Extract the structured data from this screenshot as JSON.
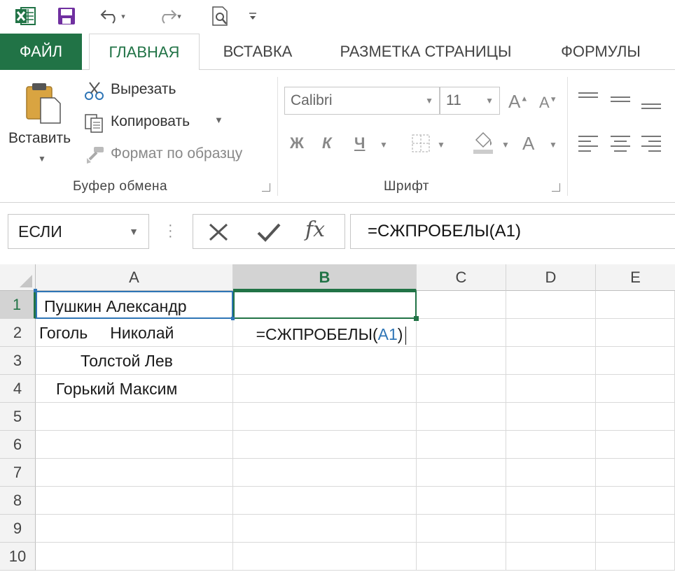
{
  "tabs": {
    "file": "ФАЙЛ",
    "home": "ГЛАВНАЯ",
    "insert": "ВСТАВКА",
    "page_layout": "РАЗМЕТКА СТРАНИЦЫ",
    "formulas": "ФОРМУЛЫ"
  },
  "ribbon": {
    "clipboard": {
      "paste": "Вставить",
      "cut": "Вырезать",
      "copy": "Копировать",
      "format_painter": "Формат по образцу",
      "group_label": "Буфер обмена"
    },
    "font": {
      "font_name": "Calibri",
      "font_size": "11",
      "bold": "Ж",
      "italic": "К",
      "underline": "Ч",
      "grow": "A",
      "shrink": "A",
      "font_color": "A",
      "group_label": "Шрифт"
    }
  },
  "formula_bar": {
    "name_box": "ЕСЛИ",
    "cancel": "✕",
    "enter": "✓",
    "fx": "fx",
    "formula": "=СЖПРОБЕЛЫ(A1)"
  },
  "grid": {
    "columns": [
      "A",
      "B",
      "C",
      "D",
      "E"
    ],
    "selected_column": "B",
    "rows": [
      "1",
      "2",
      "3",
      "4",
      "5",
      "6",
      "7",
      "8",
      "9",
      "10"
    ],
    "selected_row": "1",
    "cells": {
      "A1": "Пушкин Александр",
      "A2": "Гоголь     Николай",
      "A3": "Толстой Лев",
      "A4": "Горький Максим",
      "B1_prefix": "=СЖПРОБЕЛЫ(",
      "B1_ref": "A1",
      "B1_suffix": ")"
    }
  },
  "colors": {
    "excel_green": "#217346",
    "reference_blue": "#2e75b6"
  }
}
